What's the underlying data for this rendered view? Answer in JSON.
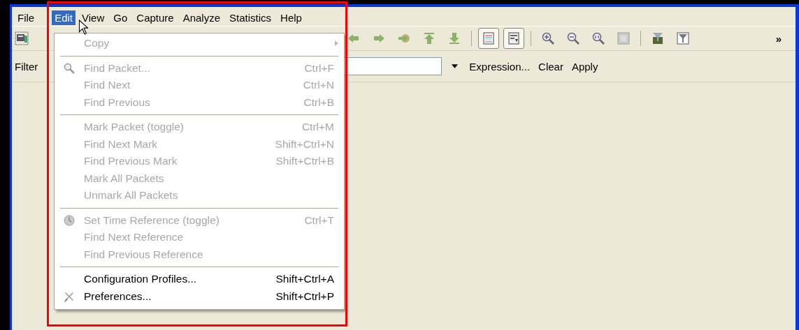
{
  "menubar": [
    {
      "label": "File",
      "selected": false
    },
    {
      "label": "Edit",
      "selected": true
    },
    {
      "label": "View",
      "selected": false
    },
    {
      "label": "Go",
      "selected": false
    },
    {
      "label": "Capture",
      "selected": false
    },
    {
      "label": "Analyze",
      "selected": false
    },
    {
      "label": "Statistics",
      "selected": false
    },
    {
      "label": "Help",
      "selected": false
    }
  ],
  "toolbar": [
    {
      "kind": "back",
      "pressed": false
    },
    {
      "kind": "forward",
      "pressed": false
    },
    {
      "kind": "goto",
      "pressed": false
    },
    {
      "kind": "top",
      "pressed": false
    },
    {
      "kind": "bottom",
      "pressed": false
    },
    {
      "kind": "sep"
    },
    {
      "kind": "colorize",
      "pressed": true
    },
    {
      "kind": "autoscroll",
      "pressed": true
    },
    {
      "kind": "sep"
    },
    {
      "kind": "zoom-in",
      "pressed": false
    },
    {
      "kind": "zoom-out",
      "pressed": false
    },
    {
      "kind": "zoom-normal",
      "pressed": false
    },
    {
      "kind": "resize",
      "pressed": false
    },
    {
      "kind": "sep"
    },
    {
      "kind": "capture-filter",
      "pressed": false
    },
    {
      "kind": "display-filter",
      "pressed": false
    }
  ],
  "toolbar_overflow": "»",
  "filter_bar": {
    "label": "Filter",
    "links": [
      "Expression...",
      "Clear",
      "Apply"
    ]
  },
  "edit_menu": [
    {
      "kind": "item",
      "label": "Copy",
      "disabled": true,
      "submenu": true
    },
    {
      "kind": "separator"
    },
    {
      "kind": "item",
      "label": "Find Packet...",
      "shortcut": "Ctrl+F",
      "disabled": true,
      "submenu": false
    },
    {
      "kind": "item",
      "label": "Find Next",
      "shortcut": "Ctrl+N",
      "disabled": true,
      "submenu": false
    },
    {
      "kind": "item",
      "label": "Find Previous",
      "shortcut": "Ctrl+B",
      "disabled": true,
      "submenu": false
    },
    {
      "kind": "separator"
    },
    {
      "kind": "item",
      "label": "Mark Packet (toggle)",
      "shortcut": "Ctrl+M",
      "disabled": true,
      "submenu": false
    },
    {
      "kind": "item",
      "label": "Find Next Mark",
      "shortcut": "Shift+Ctrl+N",
      "disabled": true,
      "submenu": false
    },
    {
      "kind": "item",
      "label": "Find Previous Mark",
      "shortcut": "Shift+Ctrl+B",
      "disabled": true,
      "submenu": false
    },
    {
      "kind": "item",
      "label": "Mark All Packets",
      "disabled": true,
      "submenu": false
    },
    {
      "kind": "item",
      "label": "Unmark All Packets",
      "disabled": true,
      "submenu": false
    },
    {
      "kind": "separator"
    },
    {
      "kind": "item",
      "label": "Set Time Reference (toggle)",
      "shortcut": "Ctrl+T",
      "disabled": true,
      "submenu": false
    },
    {
      "kind": "item",
      "label": "Find Next Reference",
      "disabled": true,
      "submenu": false
    },
    {
      "kind": "item",
      "label": "Find Previous Reference",
      "disabled": true,
      "submenu": false
    },
    {
      "kind": "separator"
    },
    {
      "kind": "item",
      "label": "Configuration Profiles...",
      "shortcut": "Shift+Ctrl+A",
      "disabled": false,
      "submenu": false
    },
    {
      "kind": "item",
      "label": "Preferences...",
      "shortcut": "Shift+Ctrl+P",
      "disabled": false,
      "submenu": false
    }
  ]
}
